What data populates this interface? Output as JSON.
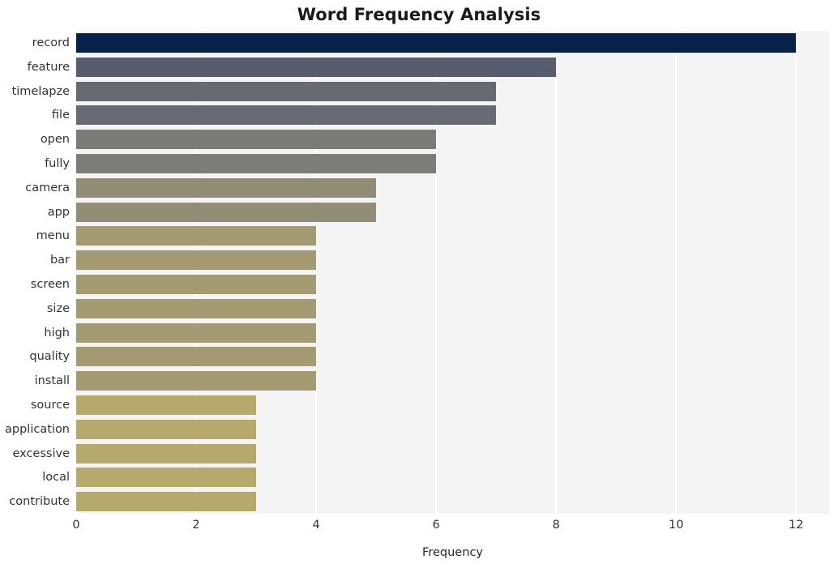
{
  "chart_data": {
    "type": "bar",
    "orientation": "horizontal",
    "title": "Word Frequency Analysis",
    "xlabel": "Frequency",
    "ylabel": "",
    "categories": [
      "record",
      "feature",
      "timelapze",
      "file",
      "open",
      "fully",
      "camera",
      "app",
      "menu",
      "bar",
      "screen",
      "size",
      "high",
      "quality",
      "install",
      "source",
      "application",
      "excessive",
      "local",
      "contribute"
    ],
    "values": [
      12,
      8,
      7,
      7,
      6,
      6,
      5,
      5,
      4,
      4,
      4,
      4,
      4,
      4,
      4,
      3,
      3,
      3,
      3,
      3
    ],
    "bar_colors": [
      "#06224b",
      "#575c6e",
      "#686a72",
      "#696b74",
      "#7b7b78",
      "#7c7c79",
      "#918c76",
      "#928d76",
      "#a39a73",
      "#a39a73",
      "#a49b73",
      "#a49b73",
      "#a49b73",
      "#a49b73",
      "#a49b73",
      "#b5a96c",
      "#b5a96c",
      "#b5a96c",
      "#b5a96c",
      "#b5a96c"
    ],
    "xlim": [
      0,
      12.55
    ],
    "x_ticks": [
      "0",
      "2",
      "4",
      "6",
      "8",
      "10",
      "12"
    ],
    "x_tick_values": [
      0,
      2,
      4,
      6,
      8,
      10,
      12
    ],
    "grid": "vertical-only",
    "legend": "none",
    "plot_background": "#f4f4f5",
    "gridline_color": "#ffffff",
    "figure_background": "#ffffff"
  }
}
